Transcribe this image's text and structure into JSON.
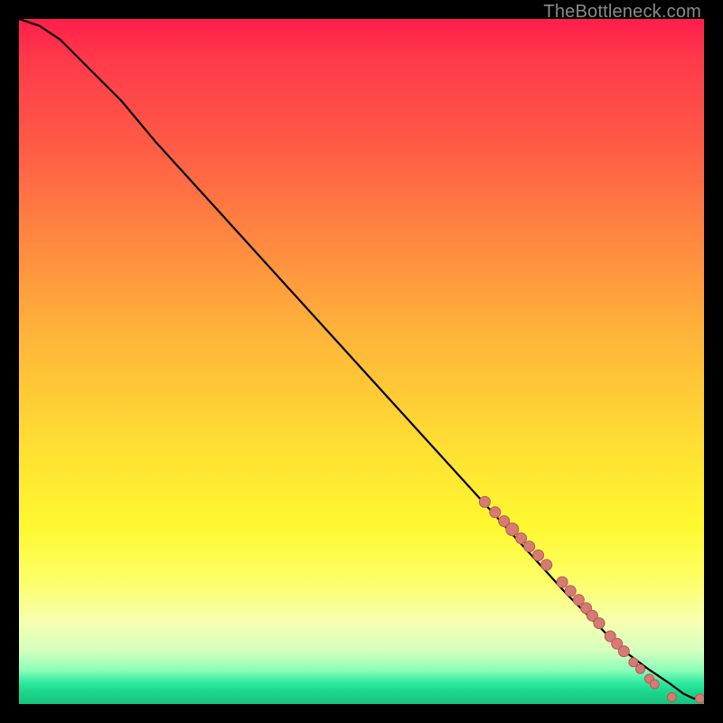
{
  "watermark": "TheBottleneck.com",
  "colors": {
    "dot_fill": "#d87a74",
    "dot_stroke": "#b45a54",
    "line": "#000000"
  },
  "chart_data": {
    "type": "line",
    "title": "",
    "xlabel": "",
    "ylabel": "",
    "xlim": [
      0,
      100
    ],
    "ylim": [
      0,
      100
    ],
    "grid": false,
    "series": [
      {
        "name": "curve",
        "x": [
          0,
          3,
          6,
          10,
          15,
          20,
          30,
          40,
          50,
          60,
          70,
          80,
          88,
          92,
          95,
          97,
          98.5,
          100
        ],
        "y": [
          100,
          99,
          97,
          93,
          88,
          82,
          71,
          60,
          49,
          38,
          27,
          16,
          8,
          5,
          3,
          1.5,
          0.8,
          0.8
        ]
      }
    ],
    "markers": [
      {
        "x": 68.0,
        "y": 29.5,
        "r": 6
      },
      {
        "x": 69.5,
        "y": 28.0,
        "r": 6
      },
      {
        "x": 70.8,
        "y": 26.7,
        "r": 6
      },
      {
        "x": 72.0,
        "y": 25.5,
        "r": 7
      },
      {
        "x": 73.3,
        "y": 24.2,
        "r": 6
      },
      {
        "x": 74.5,
        "y": 23.0,
        "r": 6
      },
      {
        "x": 75.8,
        "y": 21.7,
        "r": 6
      },
      {
        "x": 77.0,
        "y": 20.3,
        "r": 6
      },
      {
        "x": 79.3,
        "y": 17.8,
        "r": 6
      },
      {
        "x": 80.5,
        "y": 16.5,
        "r": 6
      },
      {
        "x": 81.7,
        "y": 15.2,
        "r": 6
      },
      {
        "x": 82.8,
        "y": 14.0,
        "r": 6
      },
      {
        "x": 83.7,
        "y": 12.9,
        "r": 6
      },
      {
        "x": 84.7,
        "y": 11.8,
        "r": 6
      },
      {
        "x": 86.3,
        "y": 9.9,
        "r": 6
      },
      {
        "x": 87.3,
        "y": 8.8,
        "r": 6
      },
      {
        "x": 88.3,
        "y": 7.7,
        "r": 6
      },
      {
        "x": 89.7,
        "y": 6.1,
        "r": 5
      },
      {
        "x": 90.7,
        "y": 5.1,
        "r": 5
      },
      {
        "x": 92.0,
        "y": 3.7,
        "r": 5
      },
      {
        "x": 92.8,
        "y": 2.9,
        "r": 5
      },
      {
        "x": 95.3,
        "y": 1.0,
        "r": 5
      },
      {
        "x": 99.4,
        "y": 0.8,
        "r": 5
      }
    ]
  }
}
